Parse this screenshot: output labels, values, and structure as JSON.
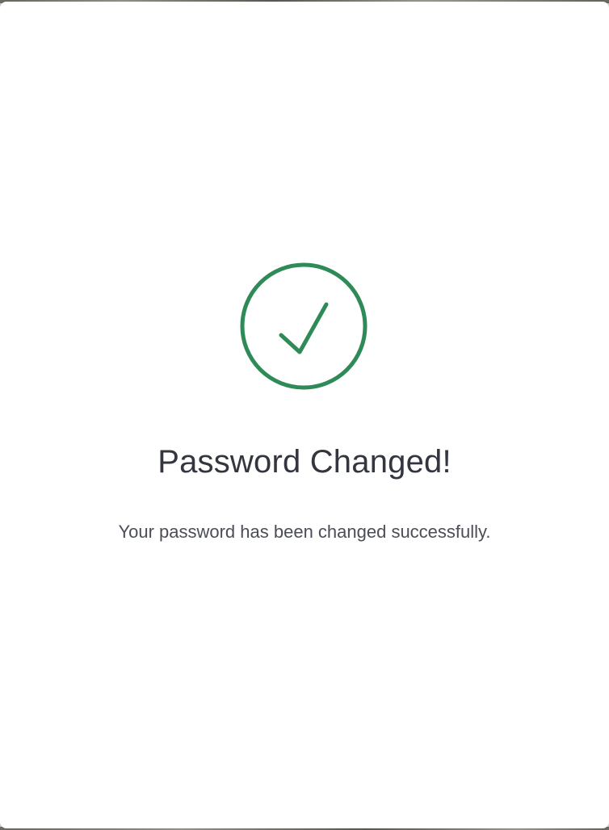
{
  "dialog": {
    "icon": "check-circle-icon",
    "title": "Password Changed!",
    "message": "Your password has been changed successfully."
  },
  "colors": {
    "success": "#2e8a57",
    "title_text": "#33353f",
    "message_text": "#4b4d57",
    "dialog_background": "#ffffff"
  }
}
